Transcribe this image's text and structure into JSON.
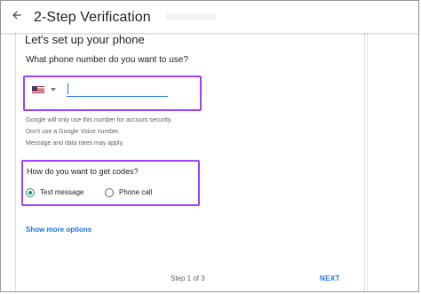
{
  "header": {
    "title": "2-Step Verification",
    "back_icon": "arrow-left-icon"
  },
  "card": {
    "heading": "Let's set up your phone",
    "phone_question": "What phone number do you want to use?",
    "country": {
      "selected": "United States",
      "flag_icon": "us-flag-icon"
    },
    "phone_input": {
      "value": "",
      "placeholder": ""
    },
    "info_lines": [
      "Google will only use this number for account security.",
      "Don't use a Google Voice number.",
      "Message and data rates may apply."
    ],
    "codes_question": "How do you want to get codes?",
    "code_options": [
      {
        "label": "Text message",
        "selected": true
      },
      {
        "label": "Phone call",
        "selected": false
      }
    ],
    "more_options_link": "Show more options"
  },
  "footer": {
    "step_text": "Step 1 of 3",
    "next_label": "NEXT"
  },
  "colors": {
    "accent_blue": "#1a73e8",
    "radio_teal": "#1a8a7e",
    "highlight_purple": "#a142f4",
    "secondary_text": "#5f6368"
  }
}
